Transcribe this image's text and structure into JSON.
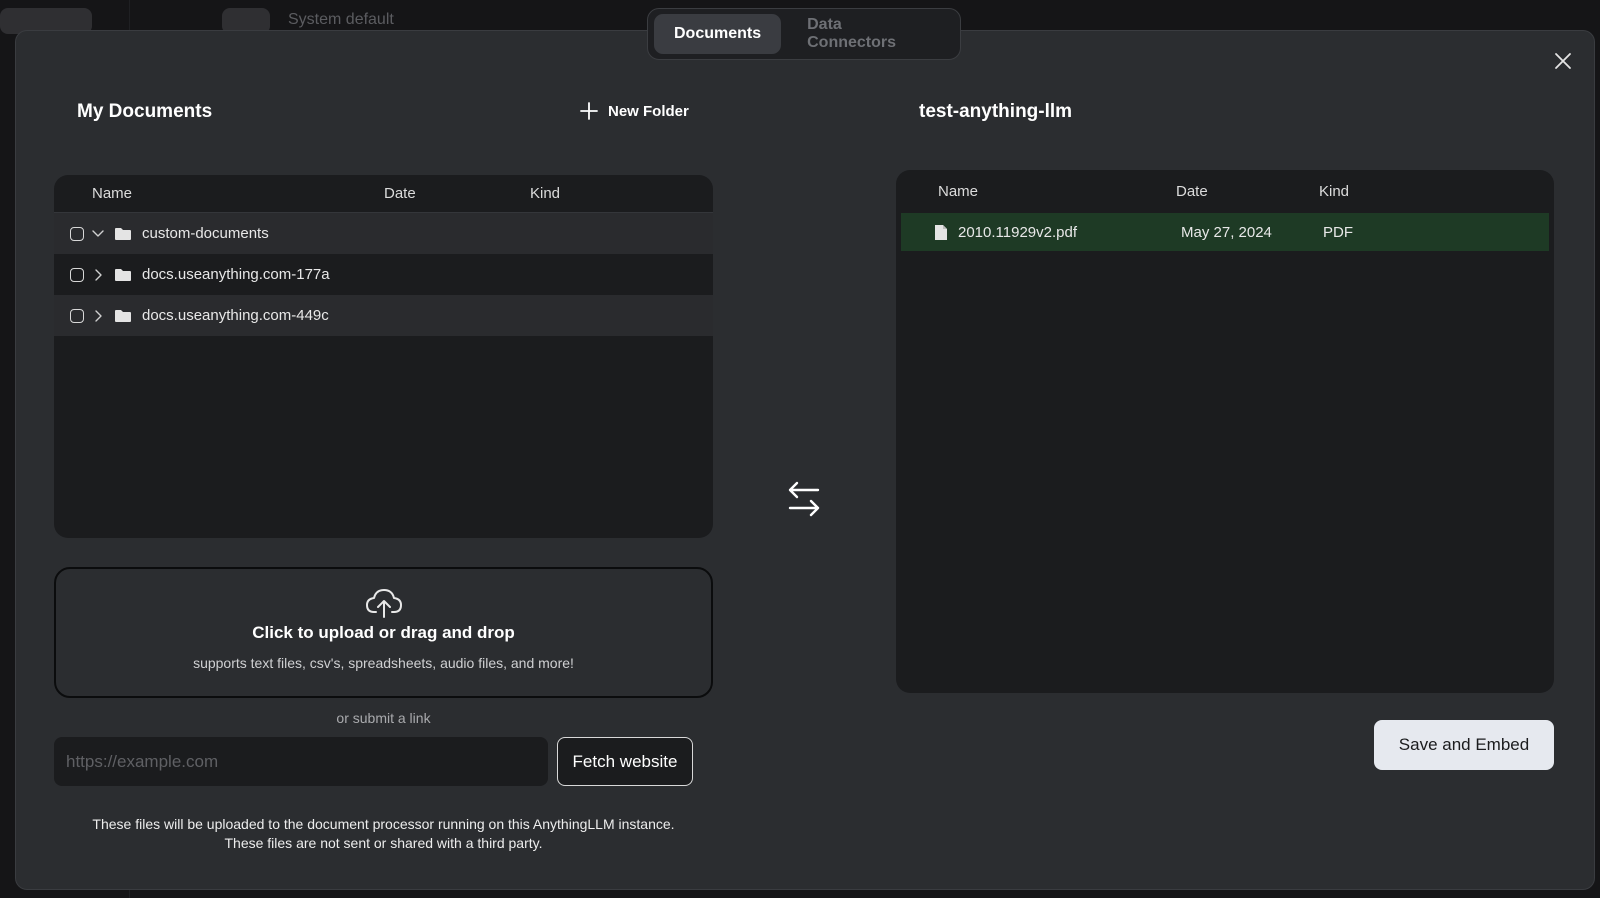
{
  "background": {
    "label": "System default"
  },
  "tabs": [
    {
      "label": "Documents",
      "active": true
    },
    {
      "label": "Data Connectors",
      "active": false
    }
  ],
  "left": {
    "title": "My Documents",
    "new_folder_label": "New Folder",
    "columns": {
      "name": "Name",
      "date": "Date",
      "kind": "Kind"
    },
    "rows": [
      {
        "name": "custom-documents",
        "expanded": true
      },
      {
        "name": "docs.useanything.com-177a",
        "expanded": false
      },
      {
        "name": "docs.useanything.com-449c",
        "expanded": false
      }
    ]
  },
  "upload": {
    "main": "Click to upload or drag and drop",
    "sub": "supports text files, csv's, spreadsheets, audio files, and more!"
  },
  "link": {
    "or_label": "or submit a link",
    "placeholder": "https://example.com",
    "fetch_label": "Fetch website"
  },
  "notice": {
    "line1": "These files will be uploaded to the document processor running on this AnythingLLM instance.",
    "line2": "These files are not sent or shared with a third party."
  },
  "right": {
    "title": "test-anything-llm",
    "columns": {
      "name": "Name",
      "date": "Date",
      "kind": "Kind"
    },
    "rows": [
      {
        "name": "2010.11929v2.pdf",
        "date": "May 27, 2024",
        "kind": "PDF"
      }
    ]
  },
  "save_label": "Save and Embed",
  "colors": {
    "modal_bg": "#2b2d30",
    "panel_bg": "#1b1c1e",
    "selected_row": "#1e3a25",
    "primary_button": "#e6e9ef"
  }
}
